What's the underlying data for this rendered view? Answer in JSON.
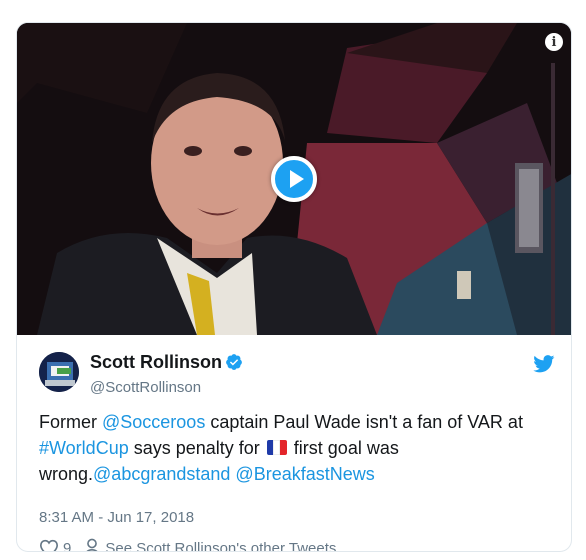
{
  "video": {
    "info_icon_label": "i",
    "play_icon": "play-icon"
  },
  "tweet": {
    "author": {
      "display_name": "Scott Rollinson",
      "handle": "@ScottRollinson",
      "verified": true
    },
    "text": {
      "part1": "Former ",
      "mention1": "@Socceroos",
      "part2": " captain Paul Wade isn't a fan of VAR at ",
      "hashtag": "#WorldCup",
      "part3": " says penalty for ",
      "flag": "france-flag",
      "part4": " first goal was wrong.",
      "mention2": "@abcgrandstand",
      "part5": " ",
      "mention3": "@BreakfastNews"
    },
    "timestamp": "8:31 AM - Jun 17, 2018",
    "likes": "9",
    "profile_link": "See Scott Rollinson's other Tweets"
  },
  "colors": {
    "link": "#1b95e0",
    "twitter_blue": "#1da1f2",
    "secondary_text": "#657786"
  }
}
